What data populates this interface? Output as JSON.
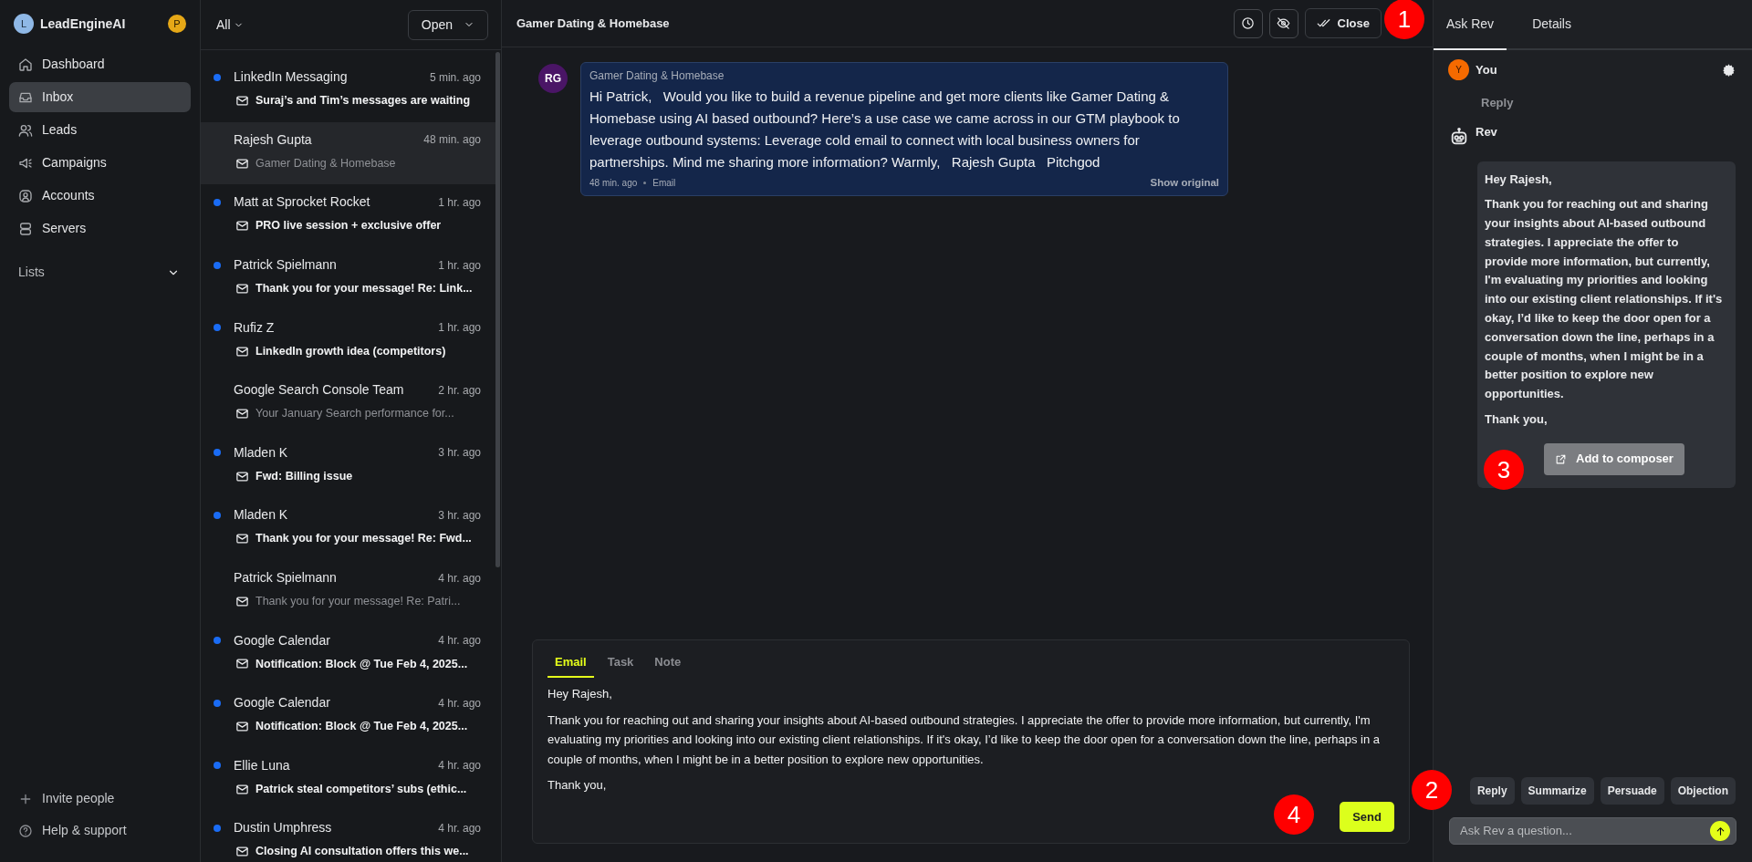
{
  "sidebar": {
    "brand": "LeadEngineAI",
    "brand_initial": "L",
    "user_initial": "P",
    "items": [
      {
        "label": "Dashboard",
        "selected": false
      },
      {
        "label": "Inbox",
        "selected": true
      },
      {
        "label": "Leads",
        "selected": false
      },
      {
        "label": "Campaigns",
        "selected": false
      },
      {
        "label": "Accounts",
        "selected": false
      },
      {
        "label": "Servers",
        "selected": false
      }
    ],
    "lists_label": "Lists",
    "footer": [
      {
        "label": "Invite people"
      },
      {
        "label": "Help & support"
      }
    ]
  },
  "inbox": {
    "filter": "All",
    "status": "Open",
    "threads": [
      {
        "sender": "LinkedIn Messaging",
        "time": "5 min. ago",
        "subject": "Suraj’s and Tim’s messages are waiting",
        "unread": true,
        "selected": false
      },
      {
        "sender": "Rajesh Gupta",
        "time": "48 min. ago",
        "subject": "Gamer Dating & Homebase",
        "unread": false,
        "selected": true
      },
      {
        "sender": "Matt at Sprocket Rocket",
        "time": "1 hr. ago",
        "subject": "PRO live session + exclusive offer",
        "unread": true,
        "selected": false
      },
      {
        "sender": "Patrick Spielmann",
        "time": "1 hr. ago",
        "subject": "Thank you for your message! Re: Link...",
        "unread": true,
        "selected": false
      },
      {
        "sender": "Rufiz Z",
        "time": "1 hr. ago",
        "subject": "LinkedIn growth idea (competitors)",
        "unread": true,
        "selected": false
      },
      {
        "sender": "Google Search Console Team",
        "time": "2 hr. ago",
        "subject": "Your January Search performance for...",
        "unread": false,
        "selected": false
      },
      {
        "sender": "Mladen K",
        "time": "3 hr. ago",
        "subject": "Fwd: Billing issue",
        "unread": true,
        "selected": false
      },
      {
        "sender": "Mladen K",
        "time": "3 hr. ago",
        "subject": "Thank you for your message! Re: Fwd...",
        "unread": true,
        "selected": false
      },
      {
        "sender": "Patrick Spielmann",
        "time": "4 hr. ago",
        "subject": "Thank you for your message! Re: Patri...",
        "unread": false,
        "selected": false
      },
      {
        "sender": "Google Calendar",
        "time": "4 hr. ago",
        "subject": "Notification: Block @ Tue Feb 4, 2025...",
        "unread": true,
        "selected": false
      },
      {
        "sender": "Google Calendar",
        "time": "4 hr. ago",
        "subject": "Notification: Block @ Tue Feb 4, 2025...",
        "unread": true,
        "selected": false
      },
      {
        "sender": "Ellie Luna",
        "time": "4 hr. ago",
        "subject": "Patrick steal competitors’ subs (ethic...",
        "unread": true,
        "selected": false
      },
      {
        "sender": "Dustin Umphress",
        "time": "4 hr. ago",
        "subject": "Closing AI consultation offers this we...",
        "unread": true,
        "selected": false
      }
    ]
  },
  "conversation": {
    "title": "Gamer Dating & Homebase",
    "close_label": "Close",
    "message": {
      "initials": "RG",
      "subject": "Gamer Dating & Homebase",
      "body": "Hi Patrick,   Would you like to build a revenue pipeline and get more clients like Gamer Dating & Homebase using AI based outbound? Here’s a use case we came across in our GTM playbook to leverage outbound systems: Leverage cold email to connect with local business owners for partnerships. Mind me sharing more information? Warmly,   Rajesh Gupta   Pitchgod",
      "time": "48 min. ago",
      "channel": "Email",
      "show_original": "Show original"
    },
    "composer": {
      "tabs": [
        {
          "label": "Email",
          "selected": true
        },
        {
          "label": "Task",
          "selected": false
        },
        {
          "label": "Note",
          "selected": false
        }
      ],
      "paragraphs": [
        "Hey Rajesh,",
        "Thank you for reaching out and sharing your insights about AI-based outbound strategies. I appreciate the offer to provide more information, but currently, I'm evaluating my priorities and looking into our existing client relationships. If it's okay, I’d like to keep the door open for a conversation down the line, perhaps in a couple of months, when I might be in a better position to explore new opportunities.",
        "Thank you,"
      ],
      "send_label": "Send"
    }
  },
  "assistant": {
    "tabs": [
      {
        "label": "Ask Rev",
        "selected": true
      },
      {
        "label": "Details",
        "selected": false
      }
    ],
    "you": {
      "initial": "Y",
      "name": "You",
      "prompt": "Reply"
    },
    "rev": {
      "name": "Rev",
      "paragraphs": [
        "Hey Rajesh,",
        "Thank you for reaching out and sharing your insights about AI-based outbound strategies. I appreciate the offer to provide more information, but currently, I'm evaluating my priorities and looking into our existing client relationships. If it's okay, I’d like to keep the door open for a conversation down the line, perhaps in a couple of months, when I might be in a better position to explore new opportunities.",
        "Thank you,"
      ],
      "add_label": "Add to composer"
    },
    "chips": [
      "Reply",
      "Summarize",
      "Persuade",
      "Objection"
    ],
    "input": {
      "placeholder": "Ask Rev a question..."
    }
  },
  "markers": [
    {
      "label": "1"
    },
    {
      "label": "2"
    },
    {
      "label": "3"
    },
    {
      "label": "4"
    }
  ]
}
